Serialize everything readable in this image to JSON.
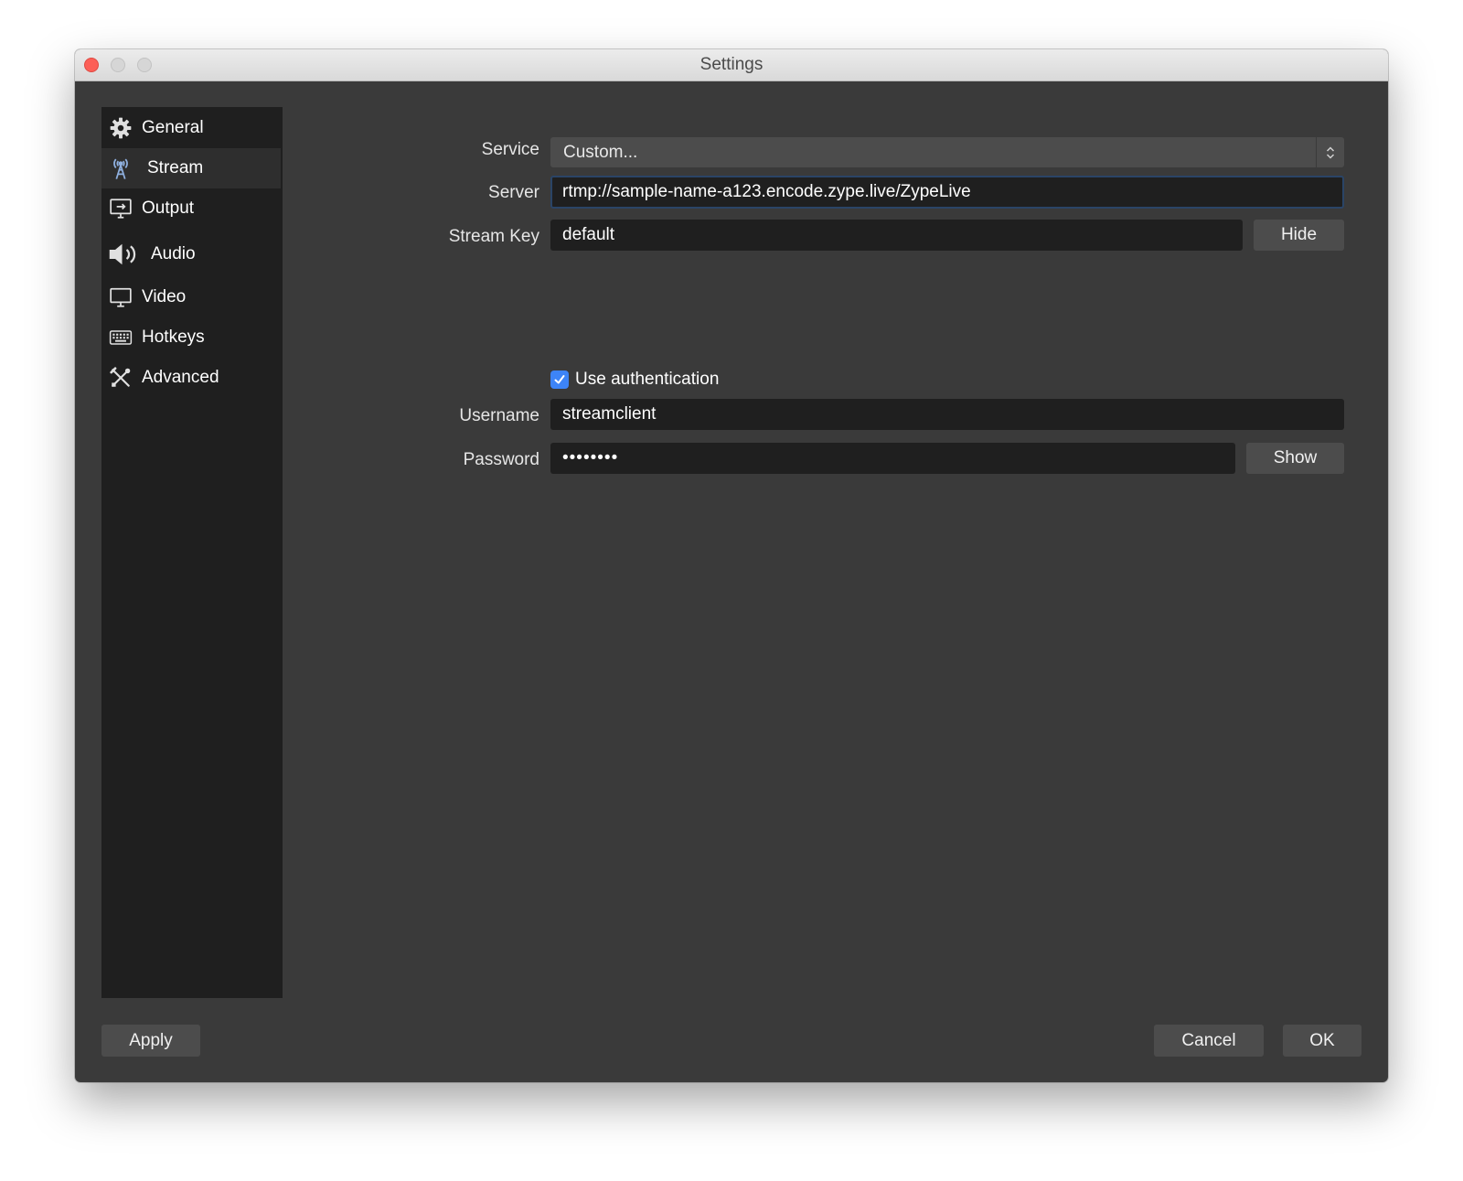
{
  "window": {
    "title": "Settings"
  },
  "sidebar": {
    "items": [
      {
        "label": "General",
        "icon": "gear-icon"
      },
      {
        "label": "Stream",
        "icon": "antenna-icon",
        "active": true
      },
      {
        "label": "Output",
        "icon": "output-icon"
      },
      {
        "label": "Audio",
        "icon": "speaker-icon"
      },
      {
        "label": "Video",
        "icon": "monitor-icon"
      },
      {
        "label": "Hotkeys",
        "icon": "keyboard-icon"
      },
      {
        "label": "Advanced",
        "icon": "tools-icon"
      }
    ]
  },
  "stream": {
    "service_label": "Service",
    "service_value": "Custom...",
    "server_label": "Server",
    "server_value": "rtmp://sample-name-a123.encode.zype.live/ZypeLive",
    "stream_key_label": "Stream Key",
    "stream_key_value": "default",
    "hide_button": "Hide",
    "use_auth_label": "Use authentication",
    "use_auth_checked": true,
    "username_label": "Username",
    "username_value": "streamclient",
    "password_label": "Password",
    "password_value": "••••••••",
    "show_button": "Show"
  },
  "footer": {
    "apply": "Apply",
    "cancel": "Cancel",
    "ok": "OK"
  },
  "colors": {
    "accent": "#3d84f7",
    "close": "#fc5f57",
    "window_bg": "#3a3a3a",
    "sidebar_bg": "#1f1f1f"
  }
}
